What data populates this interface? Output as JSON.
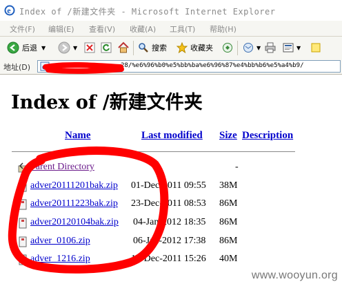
{
  "window": {
    "title": "Index of /新建文件夹 - Microsoft Internet Explorer"
  },
  "menu": [
    "文件(F)",
    "编辑(E)",
    "查看(V)",
    "收藏(A)",
    "工具(T)",
    "帮助(H)"
  ],
  "toolbar": {
    "back_label": "后退",
    "search_label": "搜索",
    "favorites_label": "收藏夹"
  },
  "address": {
    "label": "地址(D)",
    "url": "28/%e6%96%b0%e5%bb%ba%e6%96%87%e4%bb%b6%e5%a4%b9/"
  },
  "page": {
    "heading": "Index of /新建文件夹",
    "columns": {
      "name": "Name",
      "modified": "Last modified",
      "size": "Size",
      "description": "Description"
    },
    "rows": [
      {
        "name": "Parent Directory",
        "date": "",
        "size": "-",
        "icon": "back-folder-icon"
      },
      {
        "name": "adver20111201bak.zip",
        "date": "01-Dec-2011 09:55",
        "size": "38M",
        "icon": "archive-icon"
      },
      {
        "name": "adver20111223bak.zip",
        "date": "23-Dec-2011 08:53",
        "size": "86M",
        "icon": "archive-icon"
      },
      {
        "name": "adver20120104bak.zip",
        "date": "04-Jan-2012 18:35",
        "size": "86M",
        "icon": "archive-icon"
      },
      {
        "name": "adver_0106.zip",
        "date": "06-Jan-2012 17:38",
        "size": "86M",
        "icon": "archive-icon"
      },
      {
        "name": "adver_1216.zip",
        "date": "16-Dec-2011 15:26",
        "size": "40M",
        "icon": "archive-icon"
      }
    ]
  },
  "watermark": "www.wooyun.org",
  "colors": {
    "link": "#0000cc",
    "annotation": "#ff0000",
    "redaction": "#ff0000"
  }
}
